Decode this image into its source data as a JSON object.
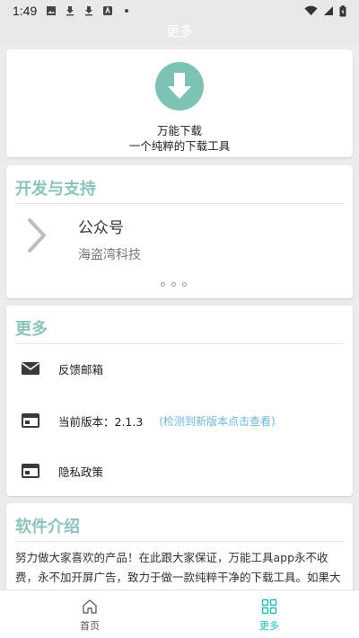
{
  "status_bar": {
    "time": "1:49"
  },
  "app": {
    "title": "更多"
  },
  "top_card": {
    "line1": "万能下载",
    "line2": "一个纯粹的下载工具"
  },
  "dev_card": {
    "heading": "开发与支持",
    "item_title": "公众号",
    "item_subtitle": "海盗湾科技"
  },
  "more_card": {
    "heading": "更多",
    "feedback": "反馈邮箱",
    "version_label": "当前版本：2.1.3",
    "version_link": "(检测到新版本点击查看)",
    "privacy": "隐私政策"
  },
  "intro_card": {
    "heading": "软件介绍",
    "text": "努力做大家喜欢的产品！在此跟大家保证，万能工具app永不收费，永不加开屏广告，致力于做一款纯粹干净的下载工具。如果大家觉得好用，可以在公众号[海盗湾科技]赞助一下，同时希望大家能"
  },
  "tabs": [
    {
      "label": "首页",
      "icon": "home-icon"
    },
    {
      "label": "更多",
      "icon": "grid-icon"
    }
  ],
  "colors": {
    "accent": "#22b8b0",
    "heading": "#8bc4bd",
    "link": "#6bb7d9",
    "download_circle": "#7cc3b3"
  }
}
